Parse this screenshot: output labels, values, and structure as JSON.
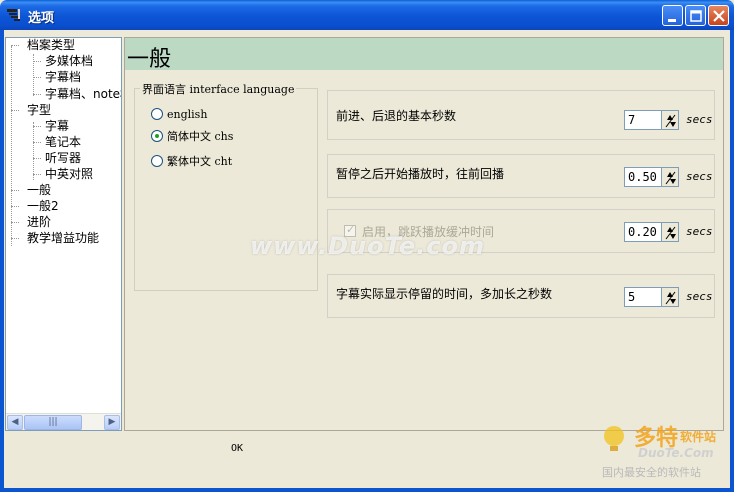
{
  "window": {
    "title": "选项"
  },
  "tree": {
    "items": [
      {
        "label": "档案类型",
        "level": 0
      },
      {
        "label": "多媒体档",
        "level": 1
      },
      {
        "label": "字幕档",
        "level": 1
      },
      {
        "label": "字幕档、note档",
        "level": 1
      },
      {
        "label": "字型",
        "level": 0
      },
      {
        "label": "字幕",
        "level": 1
      },
      {
        "label": "笔记本",
        "level": 1
      },
      {
        "label": "听写器",
        "level": 1
      },
      {
        "label": "中英对照",
        "level": 1
      },
      {
        "label": "一般",
        "level": 0
      },
      {
        "label": "一般2",
        "level": 0
      },
      {
        "label": "进阶",
        "level": 0
      },
      {
        "label": "教学增益功能",
        "level": 0
      }
    ]
  },
  "main": {
    "header_title": "一般",
    "language_group": {
      "legend": "界面语言 interface language",
      "options": [
        {
          "label": "english",
          "checked": false
        },
        {
          "label": "简体中文 chs",
          "checked": true
        },
        {
          "label": "繁体中文 cht",
          "checked": false
        }
      ]
    },
    "settings": [
      {
        "label": "前进、后退的基本秒数",
        "value": "7",
        "unit": "secs",
        "enabled": true
      },
      {
        "label": "暂停之后开始播放时，往前回播",
        "value": "0.50",
        "unit": "secs",
        "enabled": true
      },
      {
        "label": "启用，跳跃播放缓冲时间",
        "value": "0.20",
        "unit": "secs",
        "enabled": false,
        "checked": true
      },
      {
        "label": "字幕实际显示停留的时间，多加长之秒数",
        "value": "5",
        "unit": "secs",
        "enabled": true
      }
    ]
  },
  "footer": {
    "ok_label": "OK"
  },
  "watermark": {
    "center": "www.DuoTe.com",
    "logo_brand": "多特",
    "logo_sub": "软件站",
    "logo_url": "DuoTe.Com",
    "logo_slogan": "国内最安全的软件站"
  },
  "colors": {
    "titlebar": "#0d55d6",
    "header_bg": "#bcd9c4",
    "dialog_bg": "#ece9d8"
  }
}
